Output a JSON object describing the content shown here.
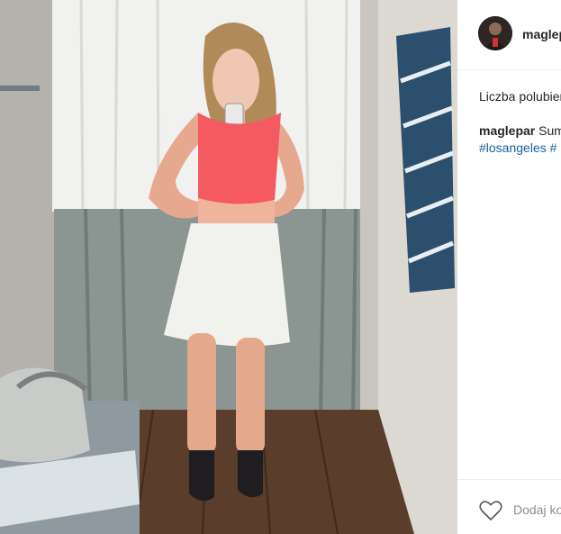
{
  "post": {
    "username": "maglepar",
    "likes_label": "Liczba polubień",
    "caption_user": "maglepar",
    "caption_text": "Sum",
    "hashtags": "#losangeles #",
    "comment_placeholder": "Dodaj komentarz..."
  },
  "icons": {
    "like": "heart-icon",
    "avatar": "avatar"
  },
  "colors": {
    "link": "#1b5f9a",
    "text": "#262626",
    "muted": "#8e8e8e",
    "divider": "#efefef"
  }
}
